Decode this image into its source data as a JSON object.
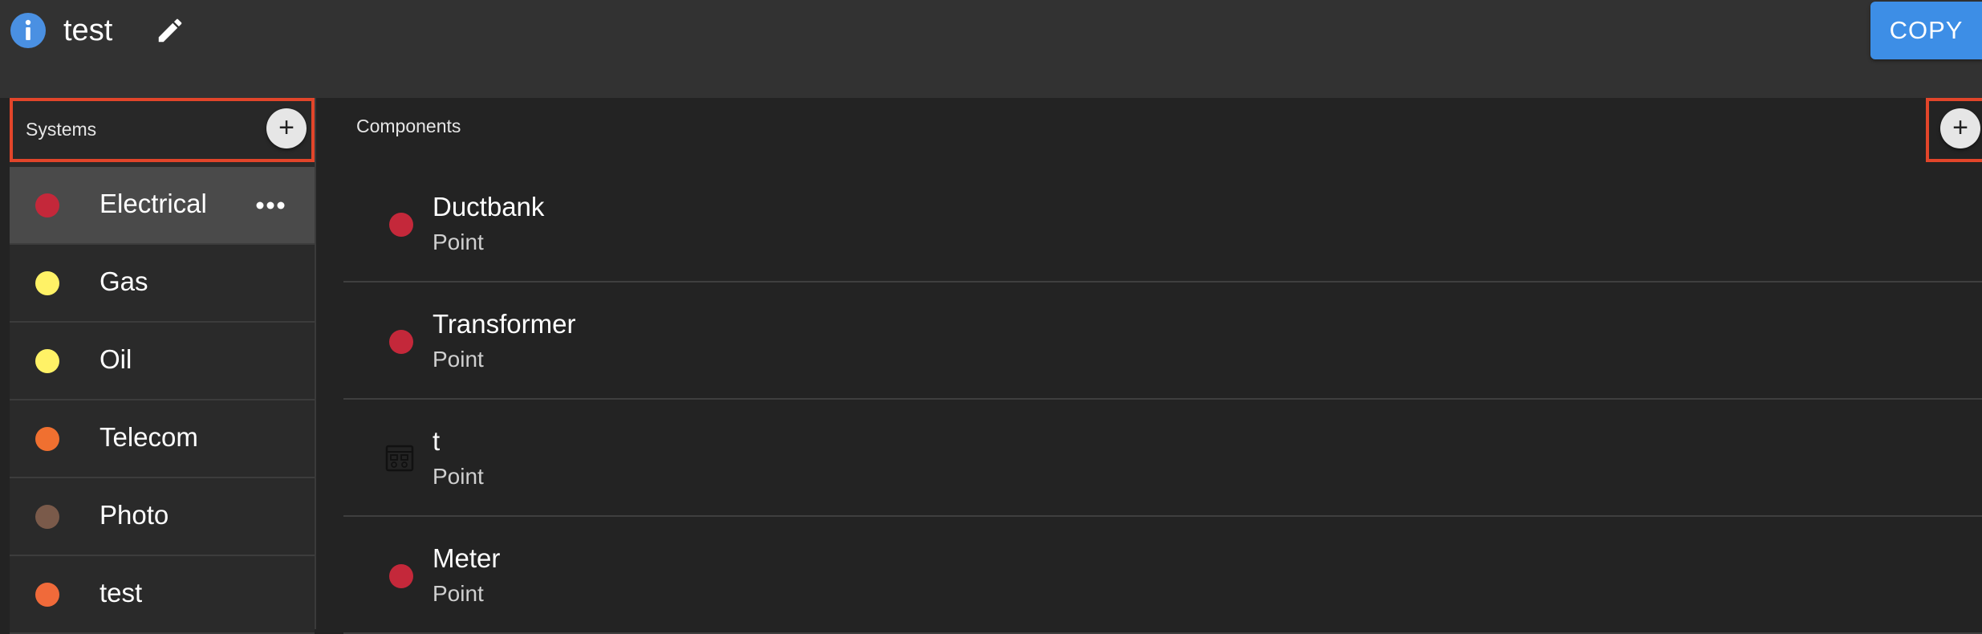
{
  "header": {
    "title": "test",
    "copy_label": "COPY"
  },
  "systems": {
    "title": "Systems",
    "add_label": "+",
    "items": [
      {
        "label": "Electrical",
        "color": "#c4283a",
        "selected": true
      },
      {
        "label": "Gas",
        "color": "#fff266"
      },
      {
        "label": "Oil",
        "color": "#fff266"
      },
      {
        "label": "Telecom",
        "color": "#f07030"
      },
      {
        "label": "Photo",
        "color": "#7a5a4a"
      },
      {
        "label": "test",
        "color": "#f06a3a"
      }
    ]
  },
  "components": {
    "title": "Components",
    "add_label": "+",
    "items": [
      {
        "name": "Ductbank",
        "type": "Point",
        "color": "#c4283a",
        "icon": "dot"
      },
      {
        "name": "Transformer",
        "type": "Point",
        "color": "#c4283a",
        "icon": "dot"
      },
      {
        "name": "t",
        "type": "Point",
        "color": "",
        "icon": "equipment-icon"
      },
      {
        "name": "Meter",
        "type": "Point",
        "color": "#c4283a",
        "icon": "dot"
      }
    ]
  },
  "colors": {
    "accent": "#3d8ee6",
    "highlight": "#e2452a",
    "info": "#4a90e2"
  }
}
